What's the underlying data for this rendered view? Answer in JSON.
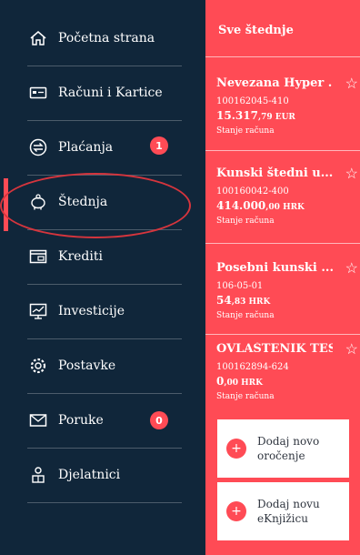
{
  "sidebar": {
    "items": [
      {
        "label": "Početna strana",
        "icon": "home-icon"
      },
      {
        "label": "Računi i Kartice",
        "icon": "card-icon"
      },
      {
        "label": "Plaćanja",
        "icon": "transfer-icon",
        "badge": "1"
      },
      {
        "label": "Štednja",
        "icon": "piggy-bank-icon"
      },
      {
        "label": "Krediti",
        "icon": "credit-card-icon"
      },
      {
        "label": "Investicije",
        "icon": "investment-chart-icon"
      },
      {
        "label": "Postavke",
        "icon": "gear-icon"
      },
      {
        "label": "Poruke",
        "icon": "envelope-icon",
        "badge": "0"
      },
      {
        "label": "Djelatnici",
        "icon": "employee-icon"
      }
    ]
  },
  "savings": {
    "title": "Sve štednje",
    "accounts": [
      {
        "name": "Nevezana Hyper ...",
        "number": "100162045-410",
        "balance_int": "15.317",
        "balance_dec": ",79 EUR",
        "caption": "Stanje računa"
      },
      {
        "name": "Kunski štedni u...",
        "number": "100160042-400",
        "balance_int": "414.000",
        "balance_dec": ",00 HRK",
        "caption": "Stanje računa"
      },
      {
        "name": "Posebni kunski ...",
        "number": "106-05-01",
        "balance_int": "54",
        "balance_dec": ",83 HRK",
        "caption": "Stanje računa"
      },
      {
        "name": "OVLAŠTENIK TEST",
        "number": "100162894-624",
        "balance_int": "0",
        "balance_dec": ",00 HRK",
        "caption": "Stanje računa"
      }
    ],
    "actions": [
      {
        "line1": "Dodaj novo",
        "line2": "oročenje"
      },
      {
        "line1": "Dodaj novu",
        "line2": "eKnjižicu"
      }
    ]
  },
  "colors": {
    "sidebar_bg": "#10263a",
    "accent": "#ff4b55"
  }
}
